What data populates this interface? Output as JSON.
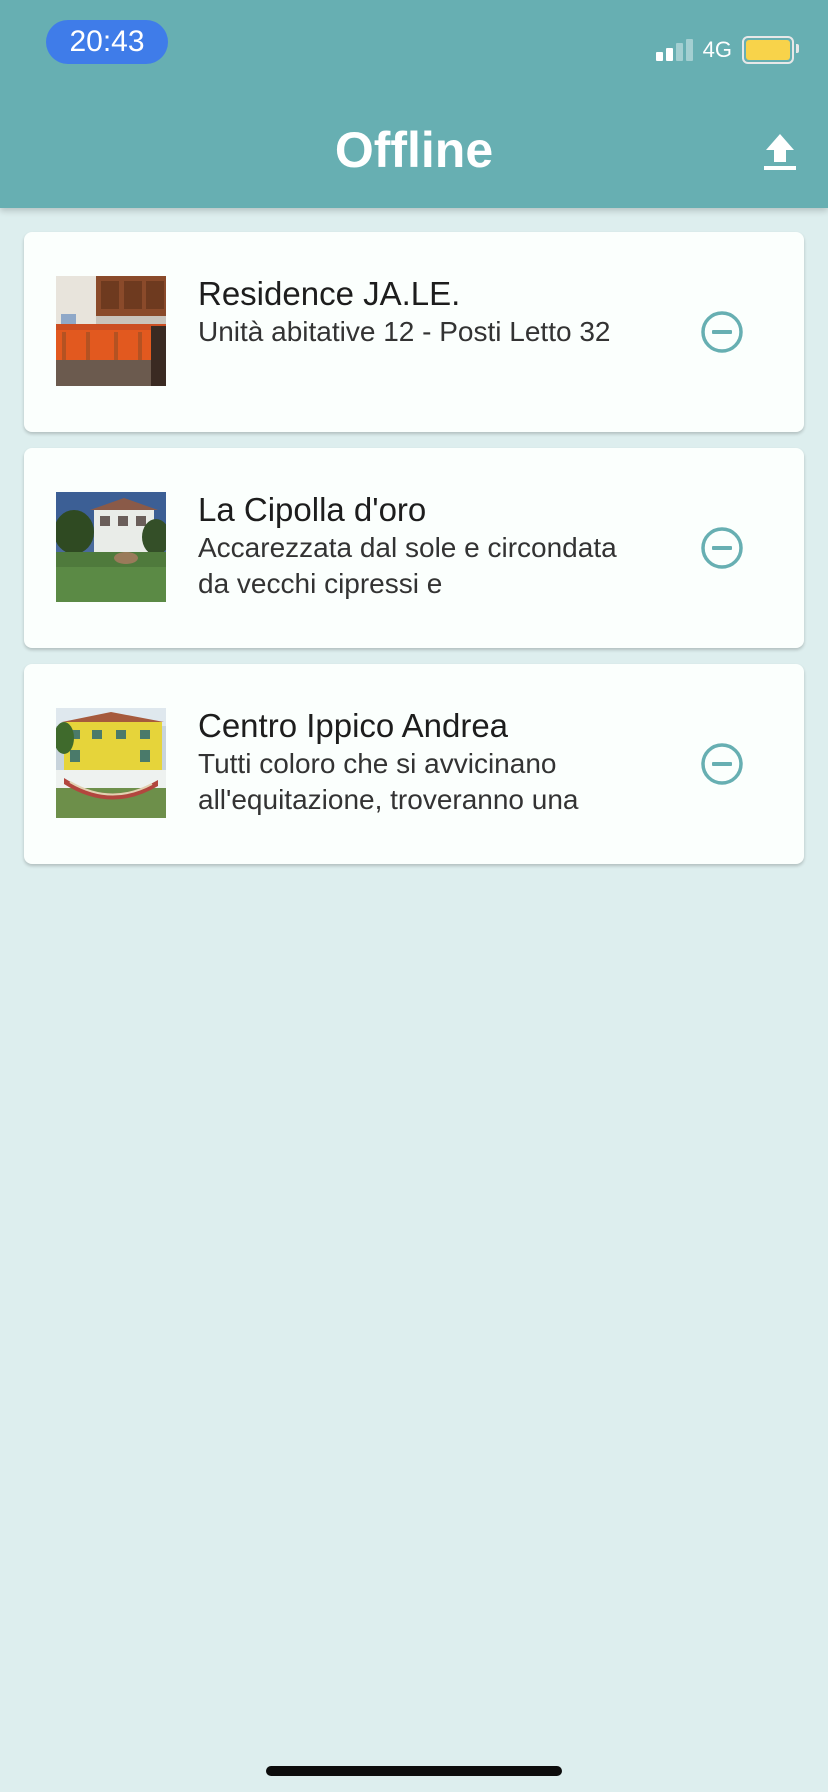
{
  "status_bar": {
    "time": "20:43",
    "network": "4G",
    "battery_color": "#f8d34a",
    "time_pill_color": "#3f7ce9"
  },
  "header": {
    "title": "Offline",
    "action_icon": "upload-icon",
    "background": "#67afb2"
  },
  "items": [
    {
      "title": "Residence JA.LE.",
      "description": "Unità abitative 12 - Posti Letto 32",
      "action_icon": "remove-circle-icon"
    },
    {
      "title": "La Cipolla d'oro",
      "description": "Accarezzata dal sole e circondata da vecchi cipressi e",
      "action_icon": "remove-circle-icon"
    },
    {
      "title": "Centro Ippico Andrea",
      "description": "Tutti coloro che si avvicinano all'equitazione, troveranno una",
      "action_icon": "remove-circle-icon"
    }
  ],
  "colors": {
    "accent": "#67afb2",
    "background": "#ddeeee",
    "card": "#fbfffd"
  }
}
